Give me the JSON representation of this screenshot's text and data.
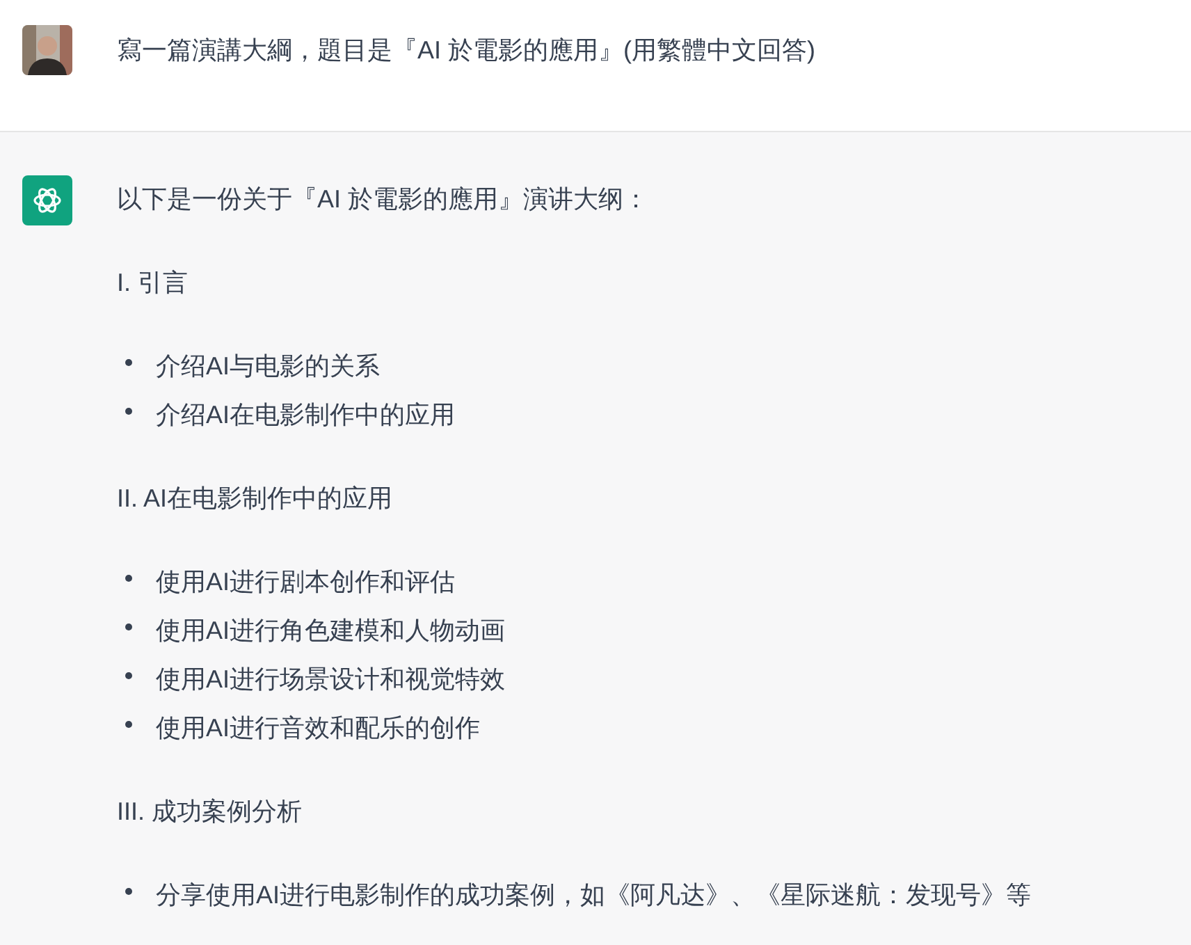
{
  "user_message": {
    "text": "寫一篇演講大綱，題目是『AI 於電影的應用』(用繁體中文回答)"
  },
  "assistant_message": {
    "intro": "以下是一份关于『AI 於電影的應用』演讲大纲：",
    "sections": [
      {
        "heading": "I. 引言",
        "bullets": [
          "介绍AI与电影的关系",
          "介绍AI在电影制作中的应用"
        ]
      },
      {
        "heading": "II. AI在电影制作中的应用",
        "bullets": [
          "使用AI进行剧本创作和评估",
          "使用AI进行角色建模和人物动画",
          "使用AI进行场景设计和视觉特效",
          "使用AI进行音效和配乐的创作"
        ]
      },
      {
        "heading": "III. 成功案例分析",
        "bullets": [
          "分享使用AI进行电影制作的成功案例，如《阿凡达》、《星际迷航：发现号》等"
        ]
      }
    ]
  }
}
